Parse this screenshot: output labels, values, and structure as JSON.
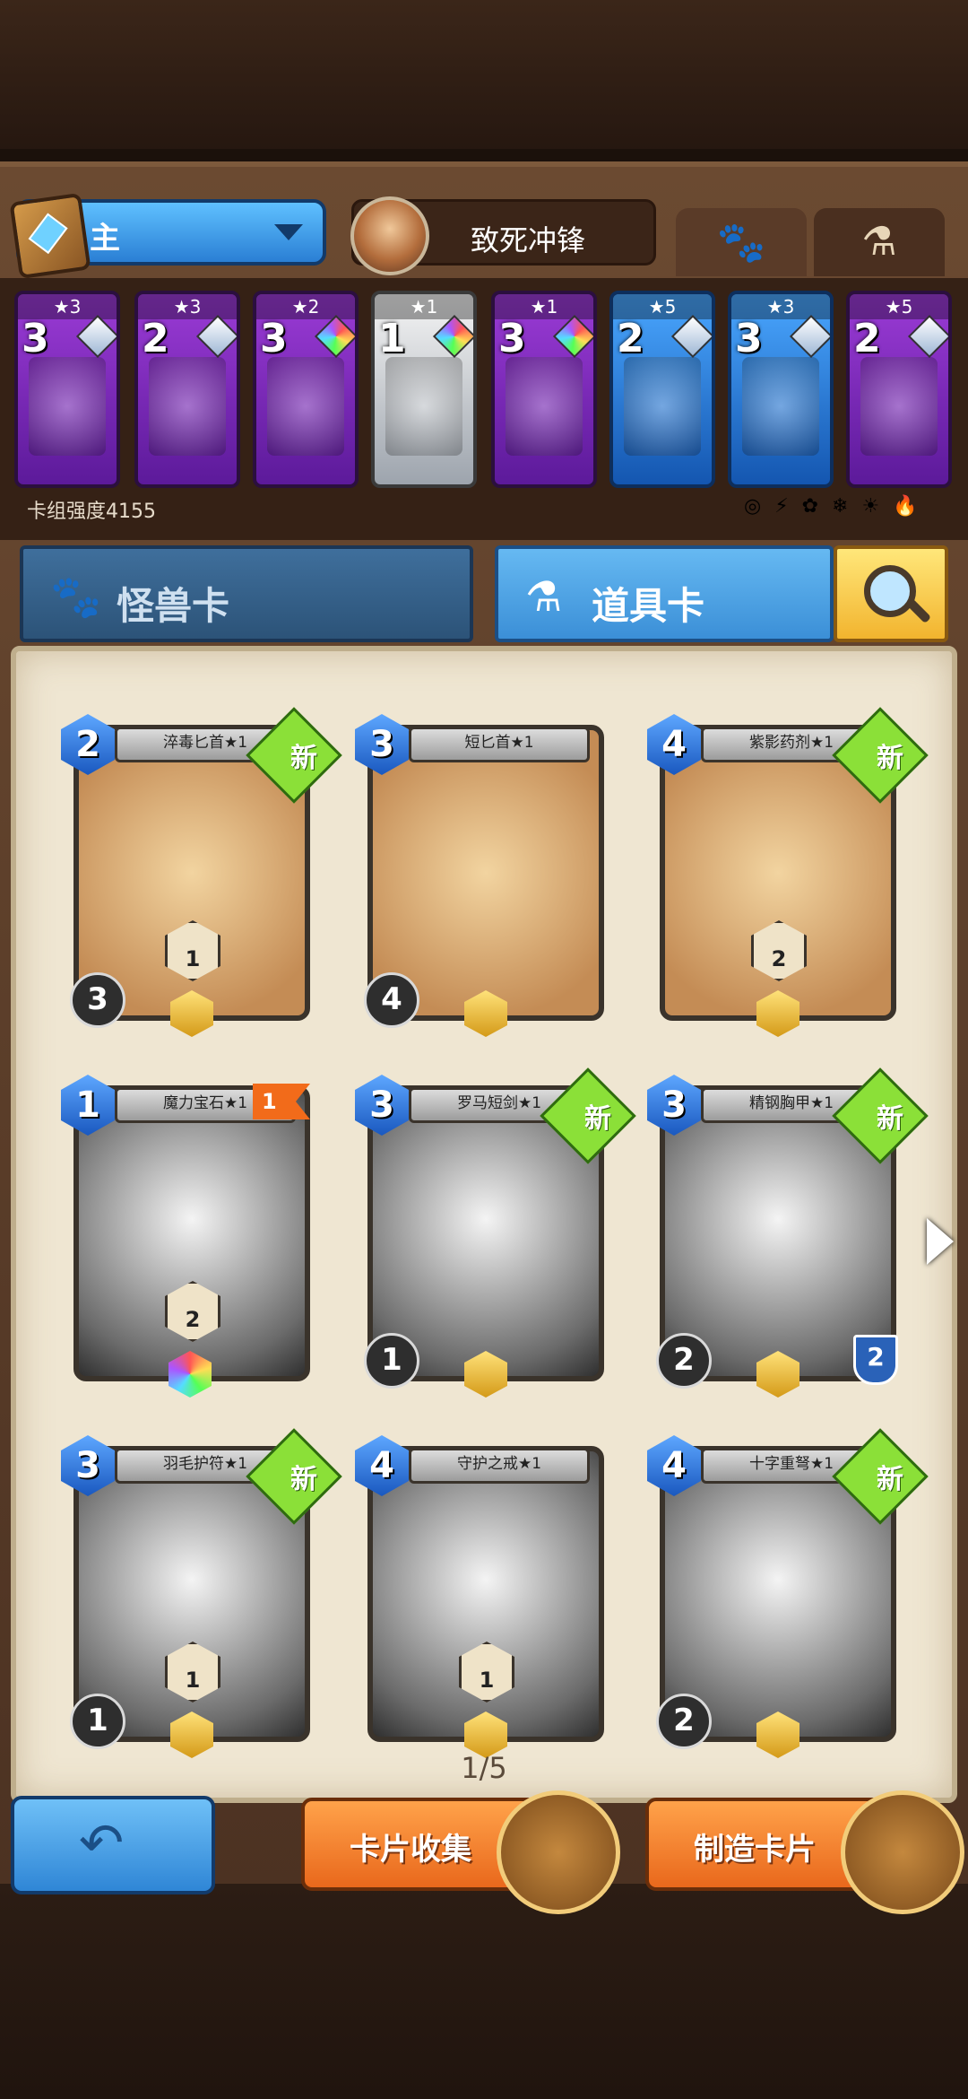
{
  "deck": {
    "name": "主",
    "hero_name": "致死冲锋",
    "power_label": "卡组强度4155",
    "element_icons": "◎ ⚡ ✿ ❄ ☀ 🔥"
  },
  "deck_cards": [
    {
      "stars": "★3",
      "cost": "3",
      "color": "purple",
      "gem": "plain"
    },
    {
      "stars": "★3",
      "cost": "2",
      "color": "purple",
      "gem": "plain"
    },
    {
      "stars": "★2",
      "cost": "3",
      "color": "purple",
      "gem": "rainbow"
    },
    {
      "stars": "★1",
      "cost": "1",
      "color": "gray",
      "gem": "rainbow"
    },
    {
      "stars": "★1",
      "cost": "3",
      "color": "purple",
      "gem": "rainbow"
    },
    {
      "stars": "★5",
      "cost": "2",
      "color": "blue",
      "gem": "plain"
    },
    {
      "stars": "★3",
      "cost": "3",
      "color": "blue",
      "gem": "plain"
    },
    {
      "stars": "★5",
      "cost": "2",
      "color": "purple",
      "gem": "plain"
    }
  ],
  "tabs": {
    "monster": "怪兽卡",
    "item": "道具卡"
  },
  "cards": [
    {
      "title": "淬毒匕首★1",
      "cost": "2",
      "new": "新",
      "level": "3",
      "badge": "1",
      "style": "tan"
    },
    {
      "title": "短匕首★1",
      "cost": "3",
      "new": "",
      "level": "4",
      "badge": "",
      "style": "tan"
    },
    {
      "title": "紫影药剂★1",
      "cost": "4",
      "new": "新",
      "level": "",
      "badge": "2",
      "style": "tan"
    },
    {
      "title": "魔力宝石★1",
      "cost": "1",
      "new": "",
      "level": "",
      "badge": "2",
      "style": "dark",
      "flag": "1"
    },
    {
      "title": "罗马短剑★1",
      "cost": "3",
      "new": "新",
      "level": "1",
      "badge": "",
      "style": "dark"
    },
    {
      "title": "精钢胸甲★1",
      "cost": "3",
      "new": "新",
      "level": "2",
      "badge": "",
      "style": "dark",
      "shield": "2"
    },
    {
      "title": "羽毛护符★1",
      "cost": "3",
      "new": "新",
      "level": "1",
      "badge": "1",
      "style": "dark"
    },
    {
      "title": "守护之戒★1",
      "cost": "4",
      "new": "",
      "level": "",
      "badge": "1",
      "style": "dark"
    },
    {
      "title": "十字重弩★1",
      "cost": "4",
      "new": "新",
      "level": "2",
      "badge": "",
      "style": "dark"
    }
  ],
  "pager": "1/5",
  "buttons": {
    "collect": "卡片收集",
    "craft": "制造卡片"
  }
}
